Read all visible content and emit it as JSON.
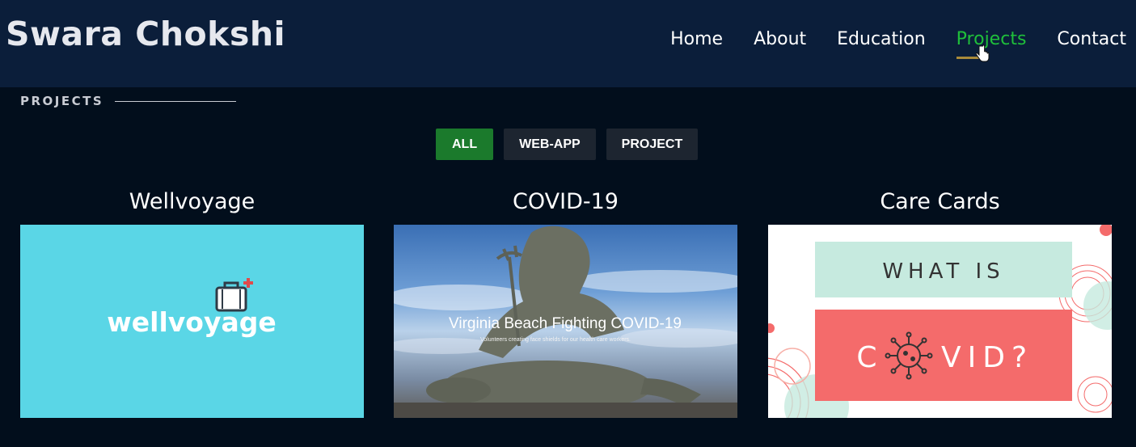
{
  "header": {
    "brand": "Swara Chokshi",
    "nav": [
      {
        "label": "Home"
      },
      {
        "label": "About"
      },
      {
        "label": "Education"
      },
      {
        "label": "Projects",
        "active": true
      },
      {
        "label": "Contact"
      }
    ]
  },
  "section": {
    "title": "PROJECTS"
  },
  "filters": [
    {
      "label": "ALL",
      "active": true
    },
    {
      "label": "WEB-APP"
    },
    {
      "label": "PROJECT"
    }
  ],
  "cards": [
    {
      "title": "Wellvoyage",
      "image_text": "wellvoyage"
    },
    {
      "title": "COVID-19",
      "image_text": "Virginia Beach Fighting COVID-19",
      "image_subtext": "Volunteers creating face shields for our health care workers."
    },
    {
      "title": "Care Cards",
      "image_text_top": "WHAT IS",
      "image_text_bottom_left": "C",
      "image_text_bottom_right": "VID?"
    }
  ],
  "colors": {
    "header_bg": "#0b1e3a",
    "page_bg": "#020e1c",
    "accent_green": "#1fbf3a",
    "filter_active": "#1b7a2c",
    "filter_inactive": "#1d2530",
    "wellvoyage_bg": "#5ad6e6",
    "care_mint": "#c6eadf",
    "care_coral": "#f46b6b"
  }
}
